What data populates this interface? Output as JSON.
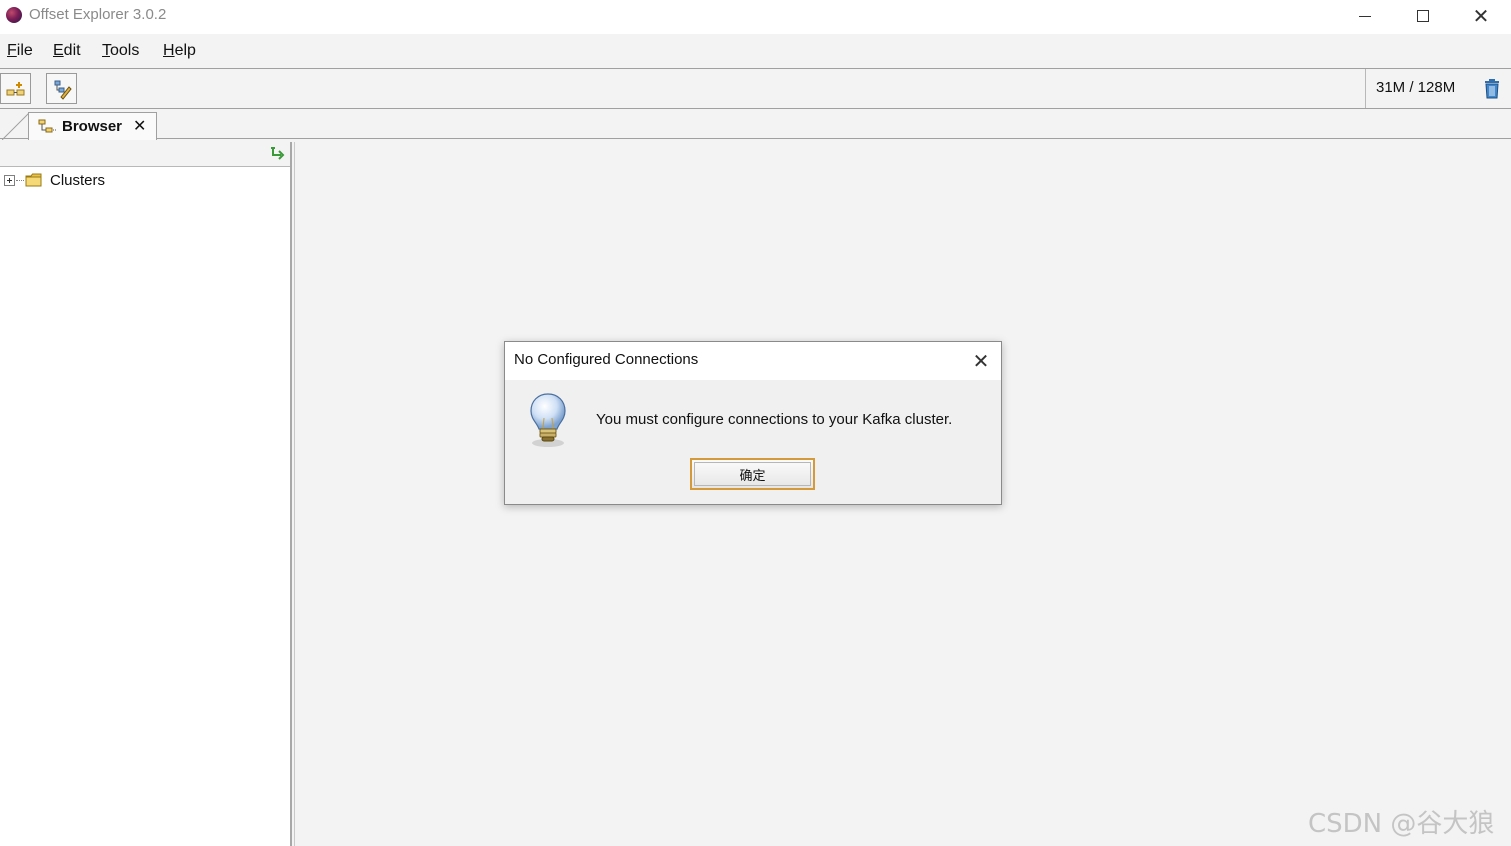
{
  "window": {
    "title": "Offset Explorer  3.0.2",
    "minimize_glyph": "",
    "close_glyph": "✕"
  },
  "menu": {
    "items": [
      {
        "mnemonic": "F",
        "rest": "ile"
      },
      {
        "mnemonic": "E",
        "rest": "dit"
      },
      {
        "mnemonic": "T",
        "rest": "ools"
      },
      {
        "mnemonic": "H",
        "rest": "elp"
      }
    ]
  },
  "toolbar": {
    "memory": "31M / 128M",
    "icons": [
      "add-connection-icon",
      "edit-connection-icon",
      "trash-icon"
    ]
  },
  "tabs": [
    {
      "label": "Browser",
      "close_glyph": "✕"
    }
  ],
  "tree": {
    "nodes": [
      {
        "label": "Clusters",
        "icon": "folder-icon",
        "expanded": false
      }
    ]
  },
  "dialog": {
    "title": "No Configured Connections",
    "close_glyph": "✕",
    "message": "You must configure connections to your Kafka cluster.",
    "ok_label": "确定",
    "icon": "lightbulb-icon"
  },
  "watermark": "CSDN @谷大狼",
  "colors": {
    "button_focus_border": "#d49a3a",
    "folder": "#e8c24a"
  }
}
